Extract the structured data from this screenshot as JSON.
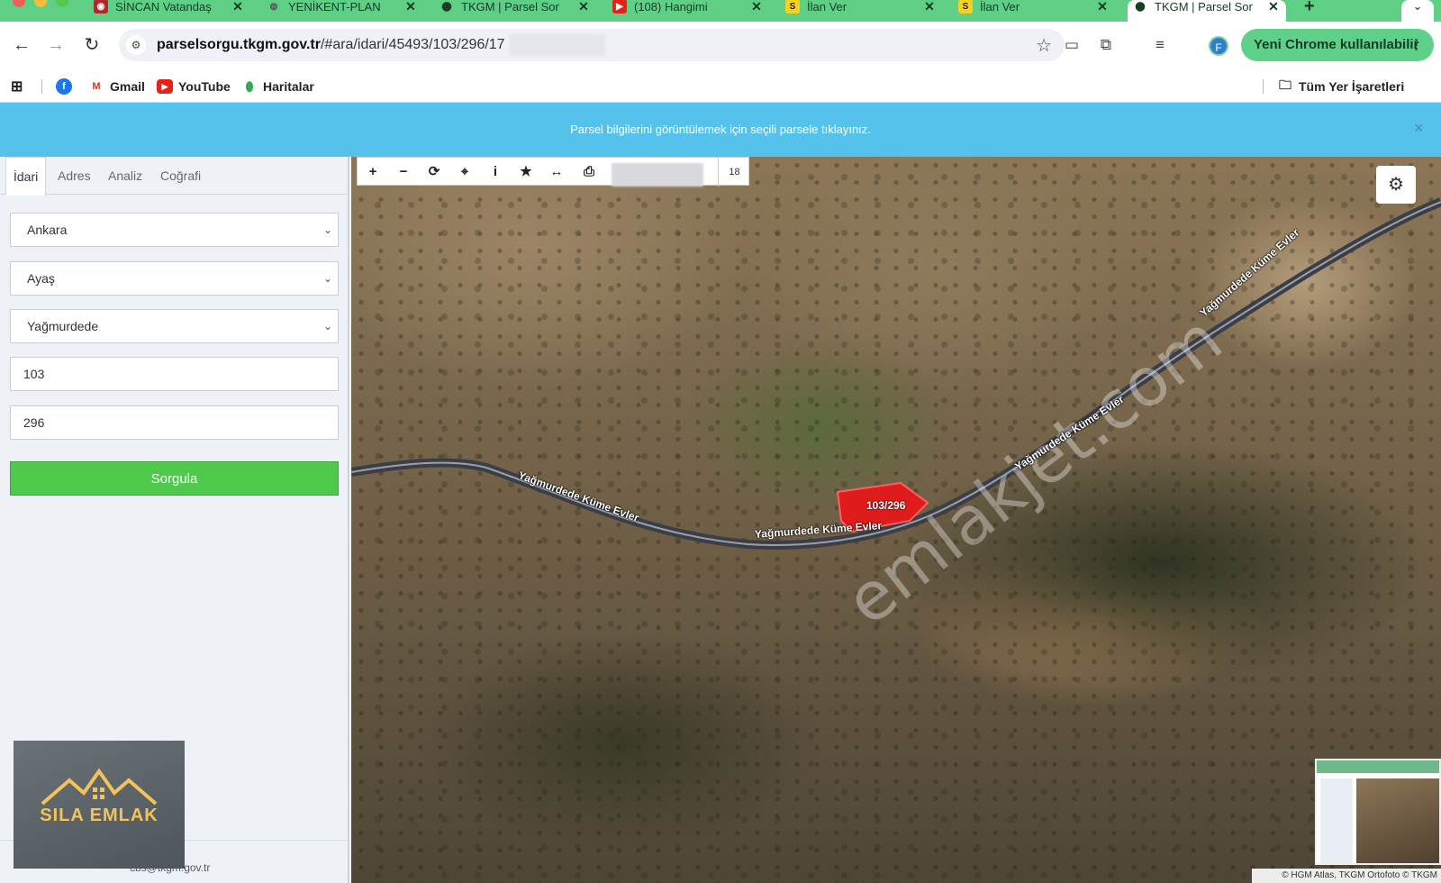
{
  "browser": {
    "tabs": [
      {
        "title": "SİNCAN Vatandaş",
        "icon": "sincan-favicon",
        "color": "#b02a2a"
      },
      {
        "title": "YENİKENT-PLAN",
        "icon": "globe-favicon",
        "color": "#555555"
      },
      {
        "title": "TKGM | Parsel Sor",
        "icon": "map-pin-favicon",
        "color": "#1b3d22"
      },
      {
        "title": "(108) Hangimi",
        "icon": "youtube-favicon",
        "color": "#e62117"
      },
      {
        "title": "İlan Ver",
        "icon": "sahibinden-favicon",
        "color": "#f5d21f"
      },
      {
        "title": "İlan Ver",
        "icon": "sahibinden-favicon",
        "color": "#f5d21f"
      },
      {
        "title": "TKGM | Parsel Sor",
        "icon": "map-pin-favicon",
        "color": "#1b3d22"
      }
    ],
    "new_tab_label": "+",
    "url_host": "parselsorgu.tkgm.gov.tr",
    "url_path": "/#ara/idari/45493/103/296/17",
    "profile_initial": "F",
    "update_button": "Yeni Chrome kullanılabilir",
    "bookmarks": [
      {
        "label": "Gmail",
        "icon": "gmail-icon"
      },
      {
        "label": "YouTube",
        "icon": "youtube-icon"
      },
      {
        "label": "Haritalar",
        "icon": "maps-icon"
      }
    ],
    "all_bookmarks": "Tüm Yer İşaretleri"
  },
  "banner": {
    "message": "Parsel bilgilerini görüntülemek için seçili parsele tıklayınız.",
    "close": "×"
  },
  "panel": {
    "tabs": [
      "İdari",
      "Adres",
      "Analiz",
      "Coğrafi"
    ],
    "active_tab": "İdari",
    "province": "Ankara",
    "district": "Ayaş",
    "neighborhood": "Yağmurdede",
    "block": "103",
    "parcel": "296",
    "query_button": "Sorgula",
    "email": "cbs@tkgm.gov.tr"
  },
  "logo": {
    "name": "SILA EMLAK",
    "color": "#f2c35a"
  },
  "map": {
    "zoom": "18",
    "tools": [
      "zoom-in-icon",
      "zoom-out-icon",
      "refresh-icon",
      "locate-icon",
      "info-icon",
      "star-icon",
      "measure-icon",
      "print-icon"
    ],
    "parcel_label": "103/296",
    "road_labels": [
      "Yağmurdede Küme Evler",
      "Yağmurdede Küme Evler",
      "Yağmurdede Küme Evler",
      "Yağmurdede Küme Evler"
    ],
    "watermark": "emlakjet.com",
    "attribution": "© HGM Atlas, TKGM Ortofoto © TKGM",
    "parcel_color": "#e01b1b"
  }
}
